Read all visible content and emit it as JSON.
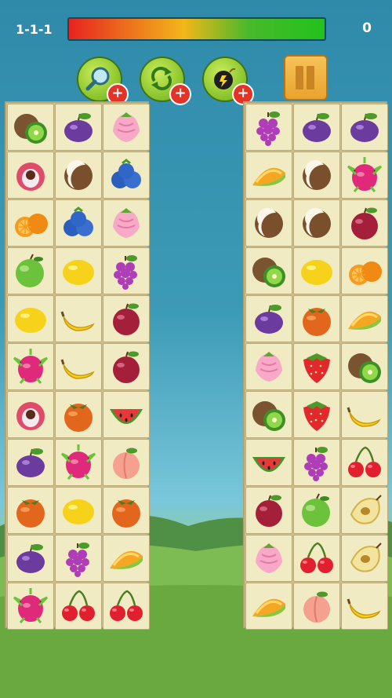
{
  "hud": {
    "level": "1-1-1",
    "score": "0",
    "timer_progress": 1.0
  },
  "powerups": [
    {
      "name": "hint",
      "icon": "magnifier-icon",
      "badge": "+"
    },
    {
      "name": "shuffle",
      "icon": "shuffle-arrows-icon",
      "badge": "+"
    },
    {
      "name": "bomb",
      "icon": "bomb-icon",
      "badge": "+"
    }
  ],
  "pause": {
    "icon": "pause-icon"
  },
  "boards": {
    "left": [
      [
        "kiwi",
        "plum",
        "shell-radish"
      ],
      [
        "lychee",
        "coconut",
        "blueberry"
      ],
      [
        "orange",
        "blueberry",
        "shell-radish"
      ],
      [
        "green-apple",
        "lemon",
        "grapes"
      ],
      [
        "lemon",
        "banana",
        "red-plum"
      ],
      [
        "dragonfruit",
        "banana",
        "red-plum"
      ],
      [
        "lychee",
        "persimmon",
        "watermelon"
      ],
      [
        "plum",
        "dragonfruit",
        "peach"
      ],
      [
        "persimmon",
        "lemon",
        "persimmon"
      ],
      [
        "plum",
        "grapes",
        "melon"
      ],
      [
        "dragonfruit",
        "cherries",
        "cherries"
      ]
    ],
    "right": [
      [
        "grapes",
        "plum",
        "plum"
      ],
      [
        "melon",
        "coconut",
        "dragonfruit"
      ],
      [
        "coconut",
        "coconut",
        "red-plum"
      ],
      [
        "kiwi",
        "lemon",
        "orange"
      ],
      [
        "plum",
        "persimmon",
        "melon"
      ],
      [
        "shell-radish",
        "strawberry",
        "kiwi"
      ],
      [
        "kiwi",
        "strawberry",
        "banana"
      ],
      [
        "watermelon",
        "grapes",
        "cherries"
      ],
      [
        "red-plum",
        "green-apple",
        "pear"
      ],
      [
        "shell-radish",
        "cherries",
        "pear"
      ],
      [
        "melon",
        "peach",
        "banana"
      ]
    ]
  }
}
